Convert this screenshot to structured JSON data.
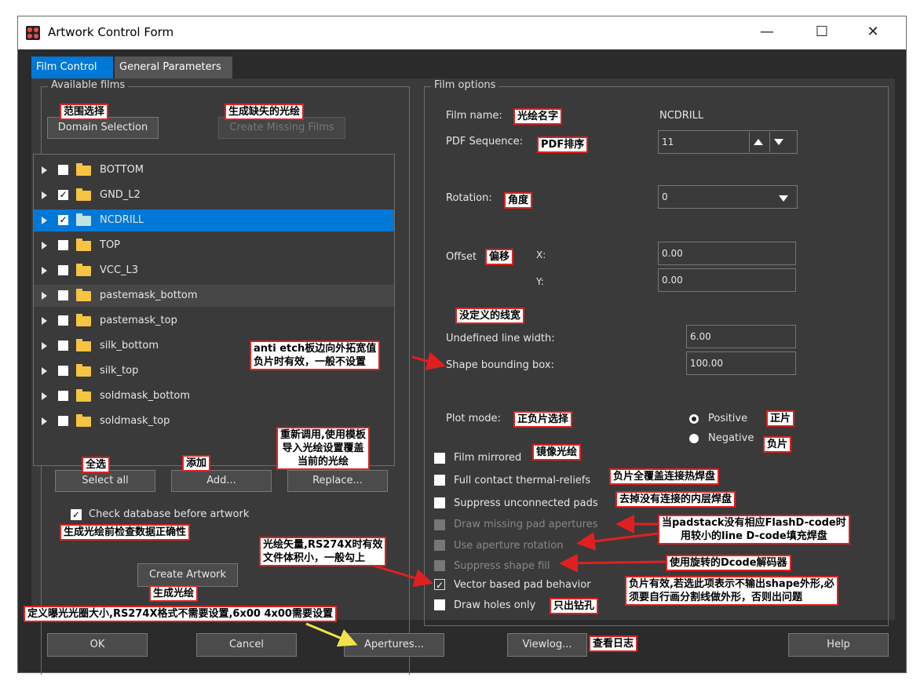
{
  "window": {
    "title": "Artwork Control Form"
  },
  "tabs": [
    {
      "label": "Film Control"
    },
    {
      "label": "General Parameters"
    }
  ],
  "available": {
    "legend": "Available films",
    "domain_btn": "Domain Selection",
    "missing_btn": "Create Missing Films",
    "films": [
      {
        "name": "BOTTOM",
        "checked": false
      },
      {
        "name": "GND_L2",
        "checked": true
      },
      {
        "name": "NCDRILL",
        "checked": true
      },
      {
        "name": "TOP",
        "checked": false
      },
      {
        "name": "VCC_L3",
        "checked": false
      },
      {
        "name": "pastemask_bottom",
        "checked": false
      },
      {
        "name": "pastemask_top",
        "checked": false
      },
      {
        "name": "silk_bottom",
        "checked": false
      },
      {
        "name": "silk_top",
        "checked": false
      },
      {
        "name": "soldmask_bottom",
        "checked": false
      },
      {
        "name": "soldmask_top",
        "checked": false
      }
    ],
    "select_all": "Select all",
    "add": "Add...",
    "replace": "Replace...",
    "check_db": "Check database before artwork",
    "create_artwork": "Create Artwork"
  },
  "options": {
    "legend": "Film options",
    "film_name_label": "Film name:",
    "film_name_value": "NCDRILL",
    "pdf_label": "PDF Sequence:",
    "pdf_value": "11",
    "rotation_label": "Rotation:",
    "rotation_value": "0",
    "offset_label": "Offset",
    "x_label": "X:",
    "y_label": "Y:",
    "x_value": "0.00",
    "y_value": "0.00",
    "undef_label": "Undefined line width:",
    "undef_value": "6.00",
    "bbox_label": "Shape bounding box:",
    "bbox_value": "100.00",
    "plot_label": "Plot mode:",
    "positive": "Positive",
    "negative": "Negative",
    "film_mirrored": "Film mirrored",
    "full_contact": "Full contact thermal-reliefs",
    "suppress_unconnected": "Suppress unconnected pads",
    "draw_missing": "Draw missing pad apertures",
    "use_rotation": "Use aperture rotation",
    "suppress_fill": "Suppress shape fill",
    "vector_pad": "Vector based pad behavior",
    "draw_holes": "Draw holes only"
  },
  "footer": {
    "ok": "OK",
    "cancel": "Cancel",
    "apertures": "Apertures...",
    "viewlog": "Viewlog...",
    "help": "Help"
  },
  "annotations": {
    "domain": "范围选择",
    "missing": "生成缺失的光绘",
    "select_all": "全选",
    "add": "添加",
    "replace": "重新调用,使用模板\n导入光绘设置覆盖\n当前的光绘",
    "check_db": "生成光绘前检查数据正确性",
    "vector": "光绘矢量,RS274X时有效\n文件体积小，一般勾上",
    "create": "生成光绘",
    "apertures": "定义曝光光圈大小,RS274X格式不需要设置,6x00 4x00需要设置",
    "film_name": "光绘名字",
    "pdf": "PDF排序",
    "rotation": "角度",
    "offset": "偏移",
    "undef": "没定义的线宽",
    "bbox": "anti etch板边向外拓宽值\n负片时有效，一般不设置",
    "plot": "正负片选择",
    "positive": "正片",
    "negative": "负片",
    "mirror": "镜像光绘",
    "full_contact": "负片全覆盖连接热焊盘",
    "suppress": "去掉没有连接的内层焊盘",
    "draw_missing": "当padstack没有相应FlashD-code时\n用较小的line D-code填充焊盘",
    "use_rotation": "使用旋转的Dcode解码器",
    "suppress_fill": "负片有效,若选此项表示不输出shape外形,必\n须要自行画分割线做外形，否则出问题",
    "holes": "只出钻孔",
    "viewlog": "查看日志"
  }
}
